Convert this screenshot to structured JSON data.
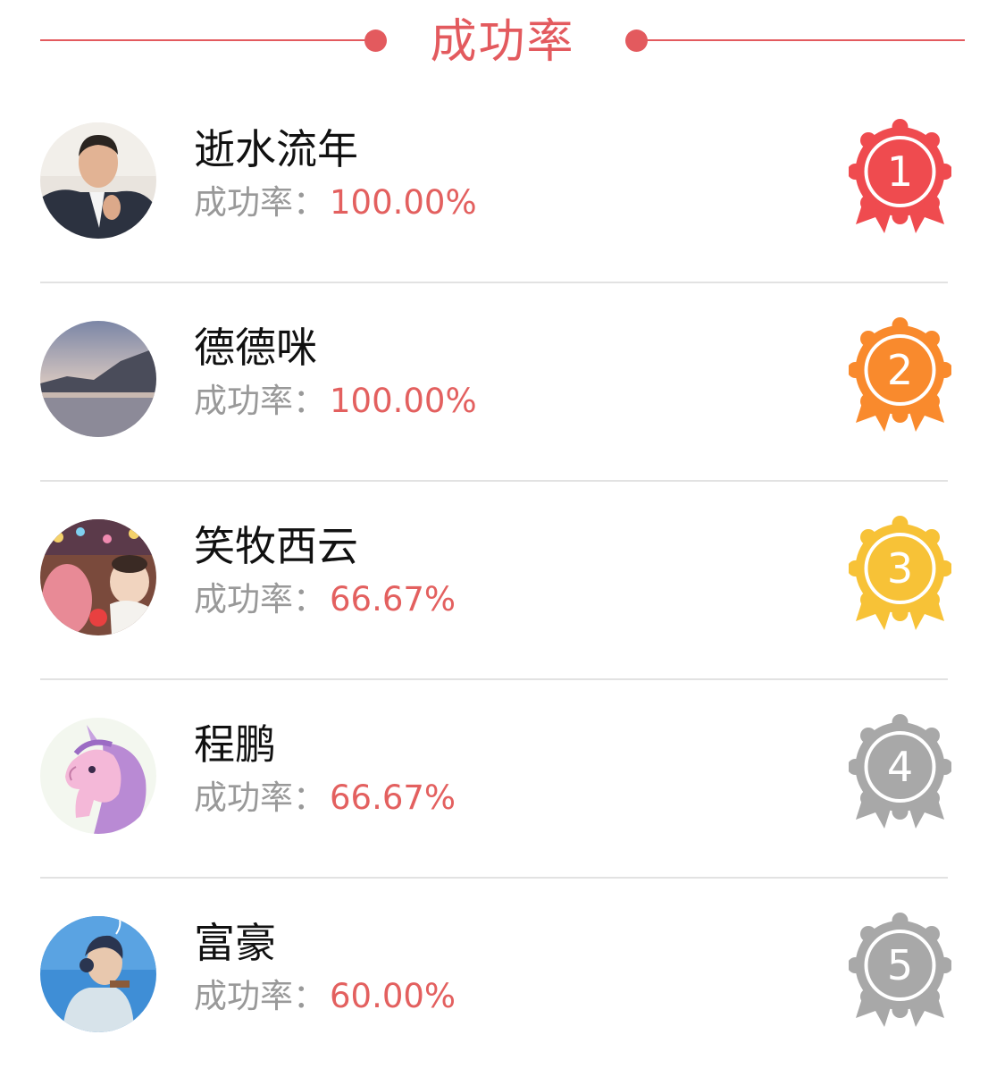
{
  "header": {
    "title": "成功率",
    "accent_color": "#e35a5e"
  },
  "rate_label": "成功率：",
  "entries": [
    {
      "rank": "1",
      "name": "逝水流年",
      "rate": "100.00%",
      "medal_color": "#ef4b4f",
      "avatar_icon": "avatar-photo-man"
    },
    {
      "rank": "2",
      "name": "德德咪",
      "rate": "100.00%",
      "medal_color": "#f98a2d",
      "avatar_icon": "avatar-photo-lake"
    },
    {
      "rank": "3",
      "name": "笑牧西云",
      "rate": "66.67%",
      "medal_color": "#f7c237",
      "avatar_icon": "avatar-photo-child"
    },
    {
      "rank": "4",
      "name": "程鹏",
      "rate": "66.67%",
      "medal_color": "#a8a8a8",
      "avatar_icon": "avatar-unicorn-cartoon"
    },
    {
      "rank": "5",
      "name": "富豪",
      "rate": "60.00%",
      "medal_color": "#a8a8a8",
      "avatar_icon": "avatar-illustration-man"
    }
  ]
}
